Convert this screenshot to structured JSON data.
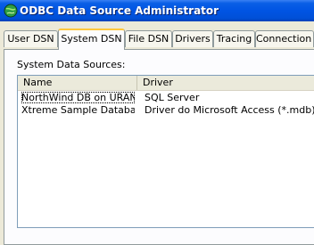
{
  "window": {
    "title": "ODBC Data Source Administrator",
    "icon": "odbc-globe-icon"
  },
  "tabs": [
    {
      "label": "User DSN",
      "active": false
    },
    {
      "label": "System DSN",
      "active": true
    },
    {
      "label": "File DSN",
      "active": false
    },
    {
      "label": "Drivers",
      "active": false
    },
    {
      "label": "Tracing",
      "active": false
    },
    {
      "label": "Connection P",
      "active": false
    }
  ],
  "system_dsn": {
    "label": "System Data Sources:",
    "columns": {
      "name": "Name",
      "driver": "Driver"
    },
    "rows": [
      {
        "name": "NorthWind DB on URAN",
        "driver": "SQL Server",
        "focused": true
      },
      {
        "name": "Xtreme Sample Databas...",
        "driver": "Driver do Microsoft Access (*.mdb)",
        "focused": false
      }
    ]
  },
  "colors": {
    "title_bar": "#0054e3",
    "dialog_bg": "#ece9d8",
    "active_tab_highlight": "#ffc73c"
  }
}
